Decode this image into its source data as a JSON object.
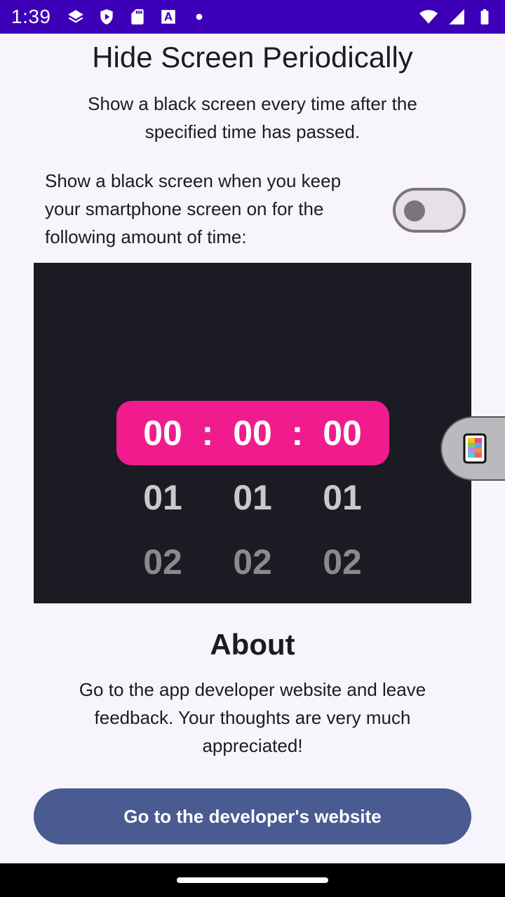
{
  "status_bar": {
    "time": "1:39",
    "left_icons": [
      "layers-icon",
      "shield-play-icon",
      "sd-card-icon",
      "font-a-icon",
      "dot-icon"
    ],
    "right_icons": [
      "wifi-icon",
      "signal-icon",
      "battery-icon"
    ]
  },
  "header": {
    "title": "Hide Screen Periodically",
    "subtitle": "Show a black screen every time after the specified time has passed."
  },
  "toggle": {
    "label": "Show a black screen when you keep your smartphone screen on for the following amount of time:",
    "enabled": false
  },
  "time_picker": {
    "separator": ":",
    "selected": {
      "hours": "00",
      "minutes": "00",
      "seconds": "00"
    },
    "next": {
      "hours": "01",
      "minutes": "01",
      "seconds": "01"
    },
    "next2": {
      "hours": "02",
      "minutes": "02",
      "seconds": "02"
    },
    "highlight_color": "#f01c8e"
  },
  "about": {
    "title": "About",
    "text": "Go to the app developer website and leave feedback. Your thoughts are very much appreciated!",
    "button_label": "Go to the developer's website"
  },
  "colors": {
    "status_bar": "#3d00b8",
    "button": "#4a5b92",
    "picker_bg": "#1b1b24"
  }
}
